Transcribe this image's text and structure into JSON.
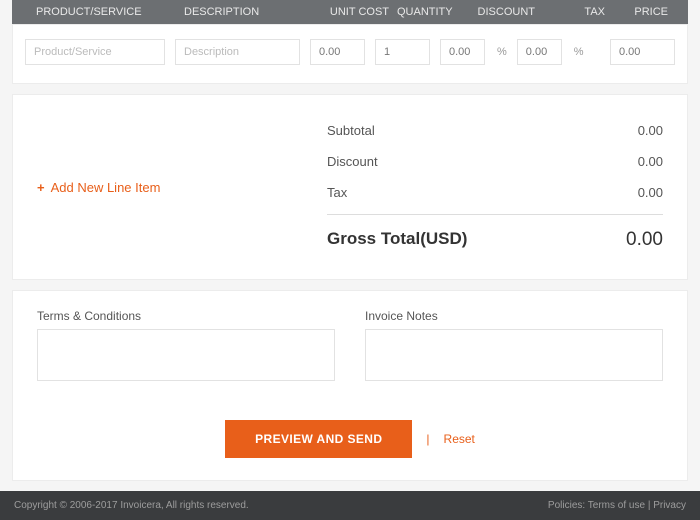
{
  "headers": {
    "product": "PRODUCT/SERVICE",
    "description": "DESCRIPTION",
    "unit_cost": "UNIT COST",
    "quantity": "QUANTITY",
    "discount": "DISCOUNT",
    "tax": "TAX",
    "price": "PRICE"
  },
  "line": {
    "product_ph": "Product/Service",
    "description_ph": "Description",
    "unit_cost": "0.00",
    "quantity": "1",
    "discount": "0.00",
    "tax": "0.00",
    "price": "0.00",
    "pct": "%"
  },
  "add_line_label": "Add New Line Item",
  "totals": {
    "subtotal_label": "Subtotal",
    "subtotal_value": "0.00",
    "discount_label": "Discount",
    "discount_value": "0.00",
    "tax_label": "Tax",
    "tax_value": "0.00",
    "gross_label": "Gross Total(USD)",
    "gross_value": "0.00"
  },
  "notes": {
    "terms_label": "Terms & Conditions",
    "notes_label": "Invoice Notes"
  },
  "actions": {
    "preview_send": "PREVIEW AND SEND",
    "divider": "|",
    "reset": "Reset"
  },
  "footer": {
    "copyright": "Copyright © 2006-2017 Invoicera, All rights reserved.",
    "policies": "Policies:",
    "terms": "Terms of use",
    "privacy": "Privacy",
    "sep": " | "
  }
}
